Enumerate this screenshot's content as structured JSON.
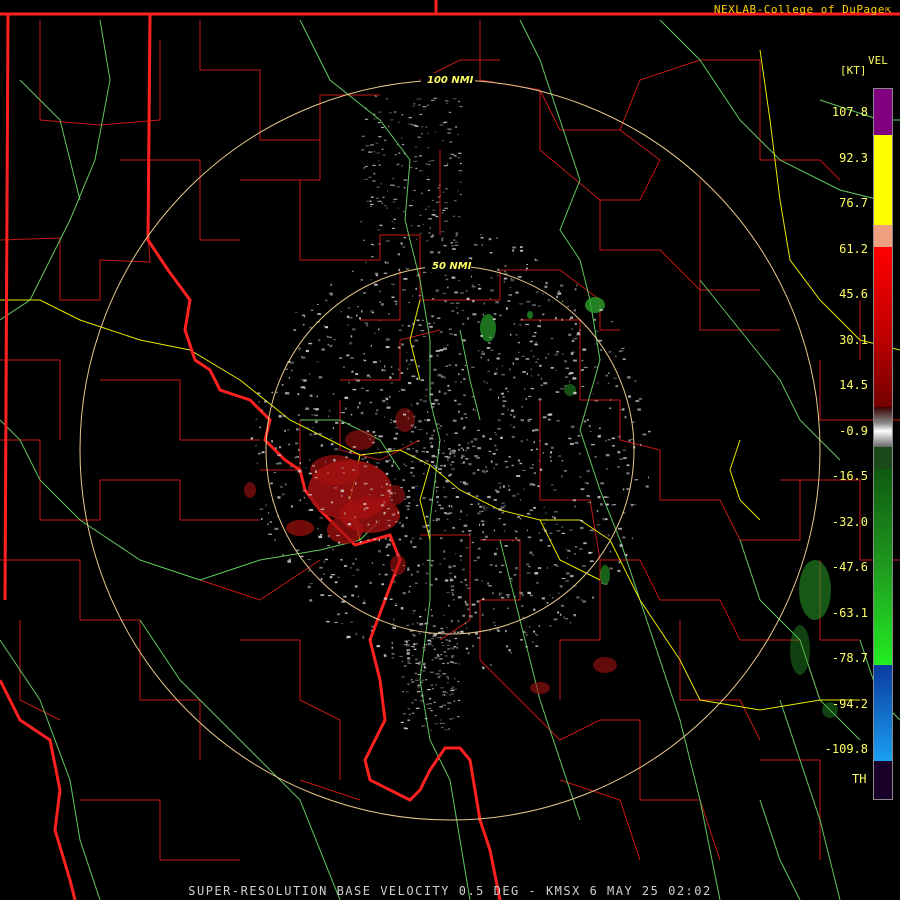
{
  "credit": "NEXLAB-College of DuPage",
  "credit_icon": "external-link-icon",
  "footer": "SUPER-RESOLUTION BASE VELOCITY 0.5 DEG - KMSX 6 MAY 25 02:02",
  "legend": {
    "title": "VEL",
    "unit": "[KT]",
    "ticks": [
      "107.8",
      "92.3",
      "76.7",
      "61.2",
      "45.6",
      "30.1",
      "14.5",
      "-0.9",
      "-16.5",
      "-32.0",
      "-47.6",
      "-63.1",
      "-78.7",
      "-94.2",
      "-109.8"
    ],
    "bottom_label": "TH"
  },
  "rings": [
    {
      "label": "50 NMI",
      "radius_nmi": 50
    },
    {
      "label": "100 NMI",
      "radius_nmi": 100
    }
  ],
  "colors": {
    "state_border": "#ff2020",
    "county_border": "#c41818",
    "highway": "#e8e800",
    "river": "#5fc75f",
    "ring": "#e8c88a",
    "ring_label": "#ffff66",
    "inbound": "#2aa02a",
    "outbound": "#b01010",
    "near_zero": "#d8d8d8"
  }
}
